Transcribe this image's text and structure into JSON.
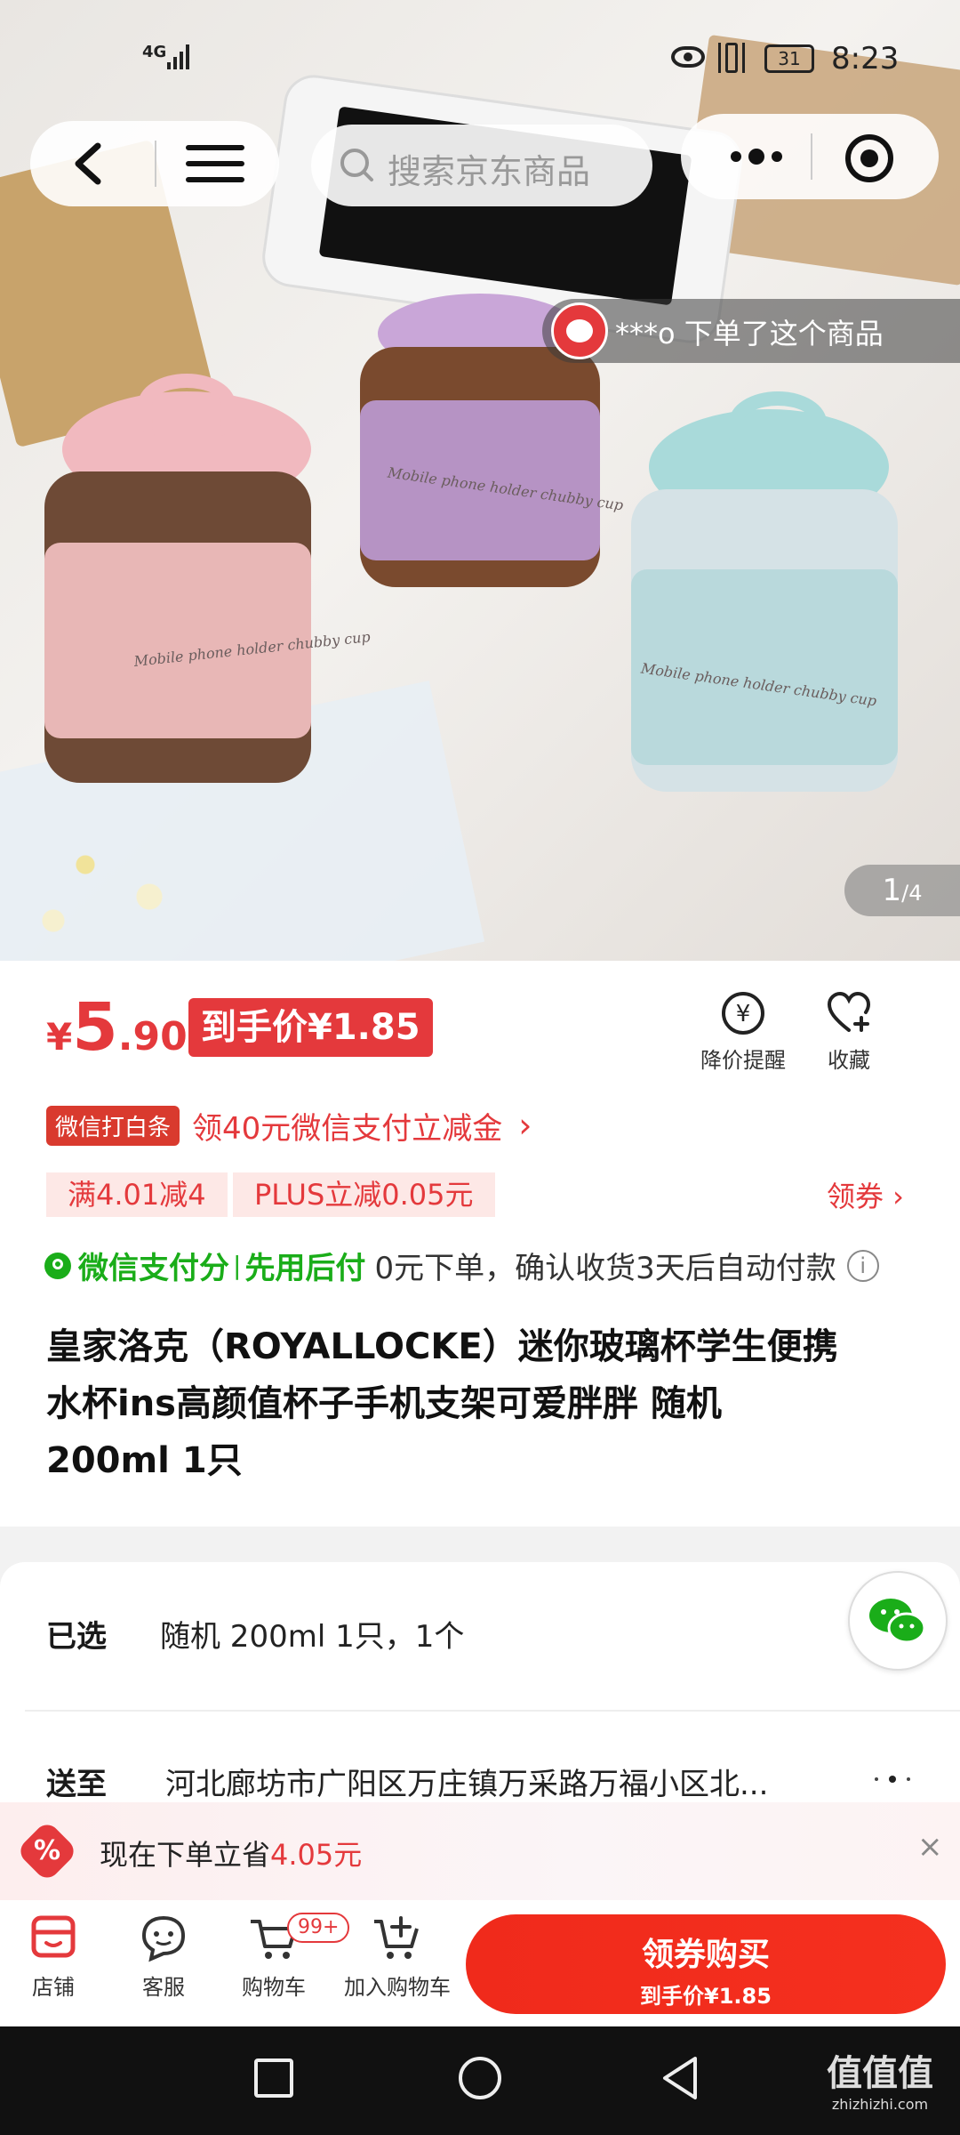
{
  "status_bar": {
    "network": "4G",
    "battery": "31",
    "time": "8:23"
  },
  "top_nav": {
    "search_placeholder": "搜索京东商品"
  },
  "hero": {
    "order_notice": "***o 下单了这个商品",
    "page_indicator_current": "1",
    "page_indicator_total": "/4",
    "cup_print": "Mobile phone holder chubby cup"
  },
  "price": {
    "currency": "¥",
    "integer": "5",
    "decimal": ".90",
    "final_label": "到手价¥1.85",
    "price_alert_label": "降价提醒",
    "favorite_label": "收藏"
  },
  "wechat_promo": {
    "badge": "微信打白条",
    "text": "领40元微信支付立减金",
    "chevron": "›"
  },
  "coupons": {
    "items": [
      "满4.01减4",
      "PLUS立减0.05元"
    ],
    "get_coupon": "领券 ›"
  },
  "pay_later": {
    "brand": "微信支付分",
    "separator": "|",
    "label": "先用后付",
    "desc": "0元下单，确认收货3天后自动付款",
    "info": "i"
  },
  "product": {
    "title_line1": "皇家洛克（ROYALLOCKE）迷你玻璃杯学生便携",
    "title_line2": "水杯ins高颜值杯子手机支架可爱胖胖 随机",
    "title_line3": "200ml 1只"
  },
  "selection": {
    "label": "已选",
    "value": "随机 200ml 1只，1个"
  },
  "shipping": {
    "label": "送至",
    "address": "河北廊坊市广阳区万庄镇万采路万福小区北..."
  },
  "promo_bar": {
    "text_prefix": "现在下单立省",
    "amount": "4.05元",
    "icon": "%",
    "close": "×"
  },
  "actions": {
    "shop": "店铺",
    "service": "客服",
    "cart": "购物车",
    "cart_badge": "99+",
    "add_cart": "加入购物车",
    "buy_main": "领券购买",
    "buy_sub": "到手价¥1.85"
  },
  "watermark": {
    "main": "值值值",
    "sub": "zhizhizhi.com"
  },
  "colors": {
    "accent": "#e4393c",
    "green": "#1aad19",
    "page_bg": "#f2f2f2"
  }
}
